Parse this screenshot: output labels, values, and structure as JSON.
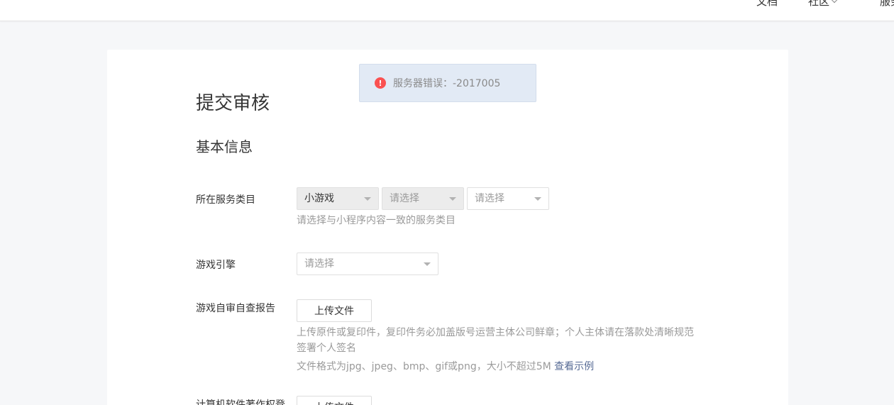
{
  "topnav": {
    "items": [
      {
        "label": "文档"
      },
      {
        "label": "社区"
      },
      {
        "label": "服务"
      }
    ]
  },
  "toast": {
    "message": "服务器错误：-2017005",
    "icon": "error-icon",
    "icon_color": "#fa5151"
  },
  "page": {
    "title": "提交审核",
    "section_title": "基本信息"
  },
  "form": {
    "category": {
      "label": "所在服务类目",
      "selects": [
        {
          "value": "小游戏"
        },
        {
          "value": "请选择"
        },
        {
          "value": "请选择"
        }
      ],
      "hint": "请选择与小程序内容一致的服务类目"
    },
    "engine": {
      "label": "游戏引擎",
      "placeholder": "请选择"
    },
    "self_check": {
      "label": "游戏自审自查报告",
      "button": "上传文件",
      "hint_line1": "上传原件或复印件，复印件务必加盖版号运营主体公司鲜章；个人主体请在落款处清晰规范",
      "hint_line2": "签署个人签名",
      "format_hint": "文件格式为jpg、jpeg、bmp、gif或png，大小不超过5M",
      "example_link": "查看示例"
    },
    "copyright": {
      "label": "计算机软件著作权登",
      "button": "上传文件"
    }
  },
  "colors": {
    "link": "#576b95",
    "toast_bg": "#e2eaf5",
    "page_bg": "#f6f7f9"
  }
}
